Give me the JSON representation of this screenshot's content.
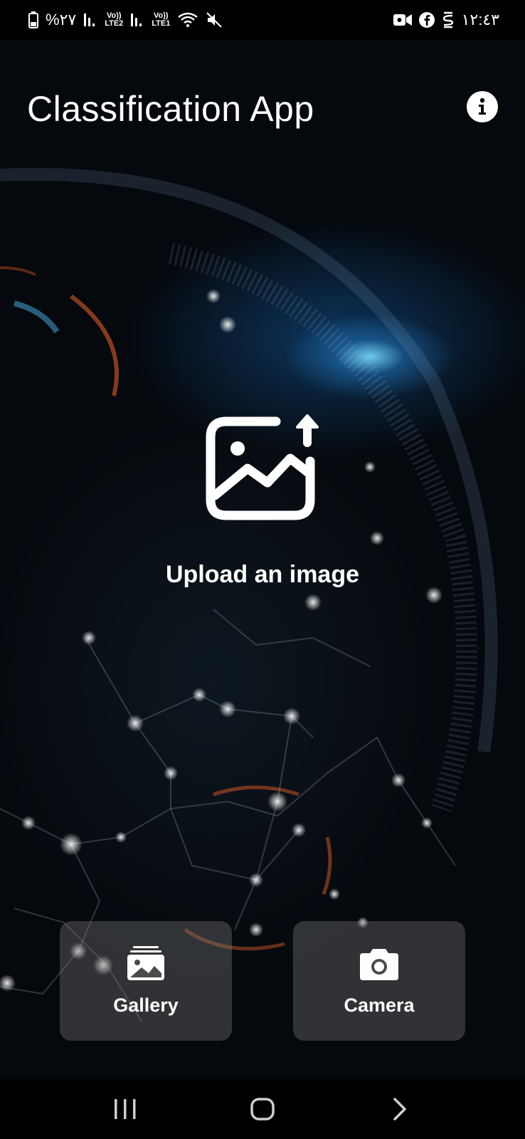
{
  "status_bar": {
    "battery_text": "%٢٧",
    "sim2_top": "Vo))",
    "sim2_bottom": "LTE2",
    "sim1_top": "Vo))",
    "sim1_bottom": "LTE1",
    "time": "١٢:٤٣"
  },
  "header": {
    "title": "Classification App",
    "info_icon": "info-icon"
  },
  "upload": {
    "icon": "image-upload-icon",
    "label": "Upload an image"
  },
  "actions": {
    "gallery_label": "Gallery",
    "gallery_icon": "gallery-icon",
    "camera_label": "Camera",
    "camera_icon": "camera-icon"
  },
  "nav_bar": {
    "recents_icon": "recents-icon",
    "home_icon": "home-icon",
    "back_icon": "back-icon"
  },
  "colors": {
    "background": "#030507",
    "accent_glow": "#2a8fd6",
    "button_bg": "rgba(120,120,120,0.38)",
    "text": "#ffffff"
  }
}
